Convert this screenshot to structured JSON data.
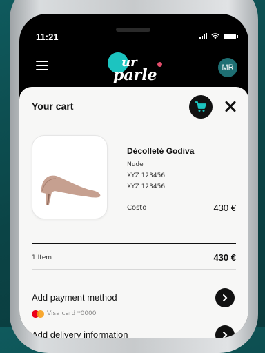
{
  "status_bar": {
    "time": "11:21"
  },
  "header": {
    "logo_line1": "ur",
    "logo_line2": "parle",
    "avatar_initials": "MR"
  },
  "cart": {
    "title": "Your cart",
    "product": {
      "name": "Décolleté Godiva",
      "color": "Nude",
      "code1": "XYZ 123456",
      "code2": "XYZ 123456",
      "cost_label": "Costo",
      "cost_value": "430 €"
    },
    "summary": {
      "items_label": "1 Item",
      "total": "430 €"
    },
    "payment": {
      "title": "Add payment method",
      "card": "Visa card *0000"
    },
    "delivery": {
      "title": "Add delivery information"
    }
  },
  "colors": {
    "brand_teal": "#1cc4c0",
    "accent_pink": "#e24c6b",
    "background": "#0b4446"
  }
}
